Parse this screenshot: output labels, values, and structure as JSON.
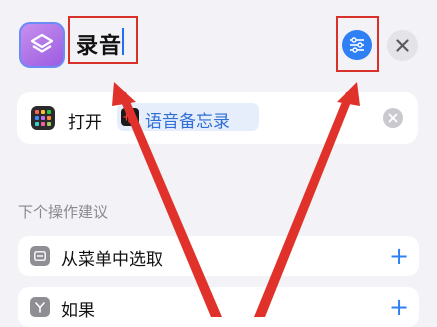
{
  "header": {
    "shortcut_name": "录音",
    "icon": "layers-icon",
    "settings_icon": "sliders-icon",
    "close_icon": "close-icon"
  },
  "action": {
    "open_label": "打开",
    "app_name": "语音备忘录",
    "app_icon": "voice-memos-icon",
    "clear_icon": "clear-icon"
  },
  "suggestions": {
    "title": "下个操作建议",
    "items": [
      {
        "label": "从菜单中选取",
        "icon": "menu-icon"
      },
      {
        "label": "如果",
        "icon": "branch-icon"
      }
    ],
    "add_symbol": "+"
  },
  "colors": {
    "accent": "#2f7ff5",
    "annotation": "#d9302a",
    "app_icon": "#b078ea",
    "background": "#f2f2f7"
  }
}
